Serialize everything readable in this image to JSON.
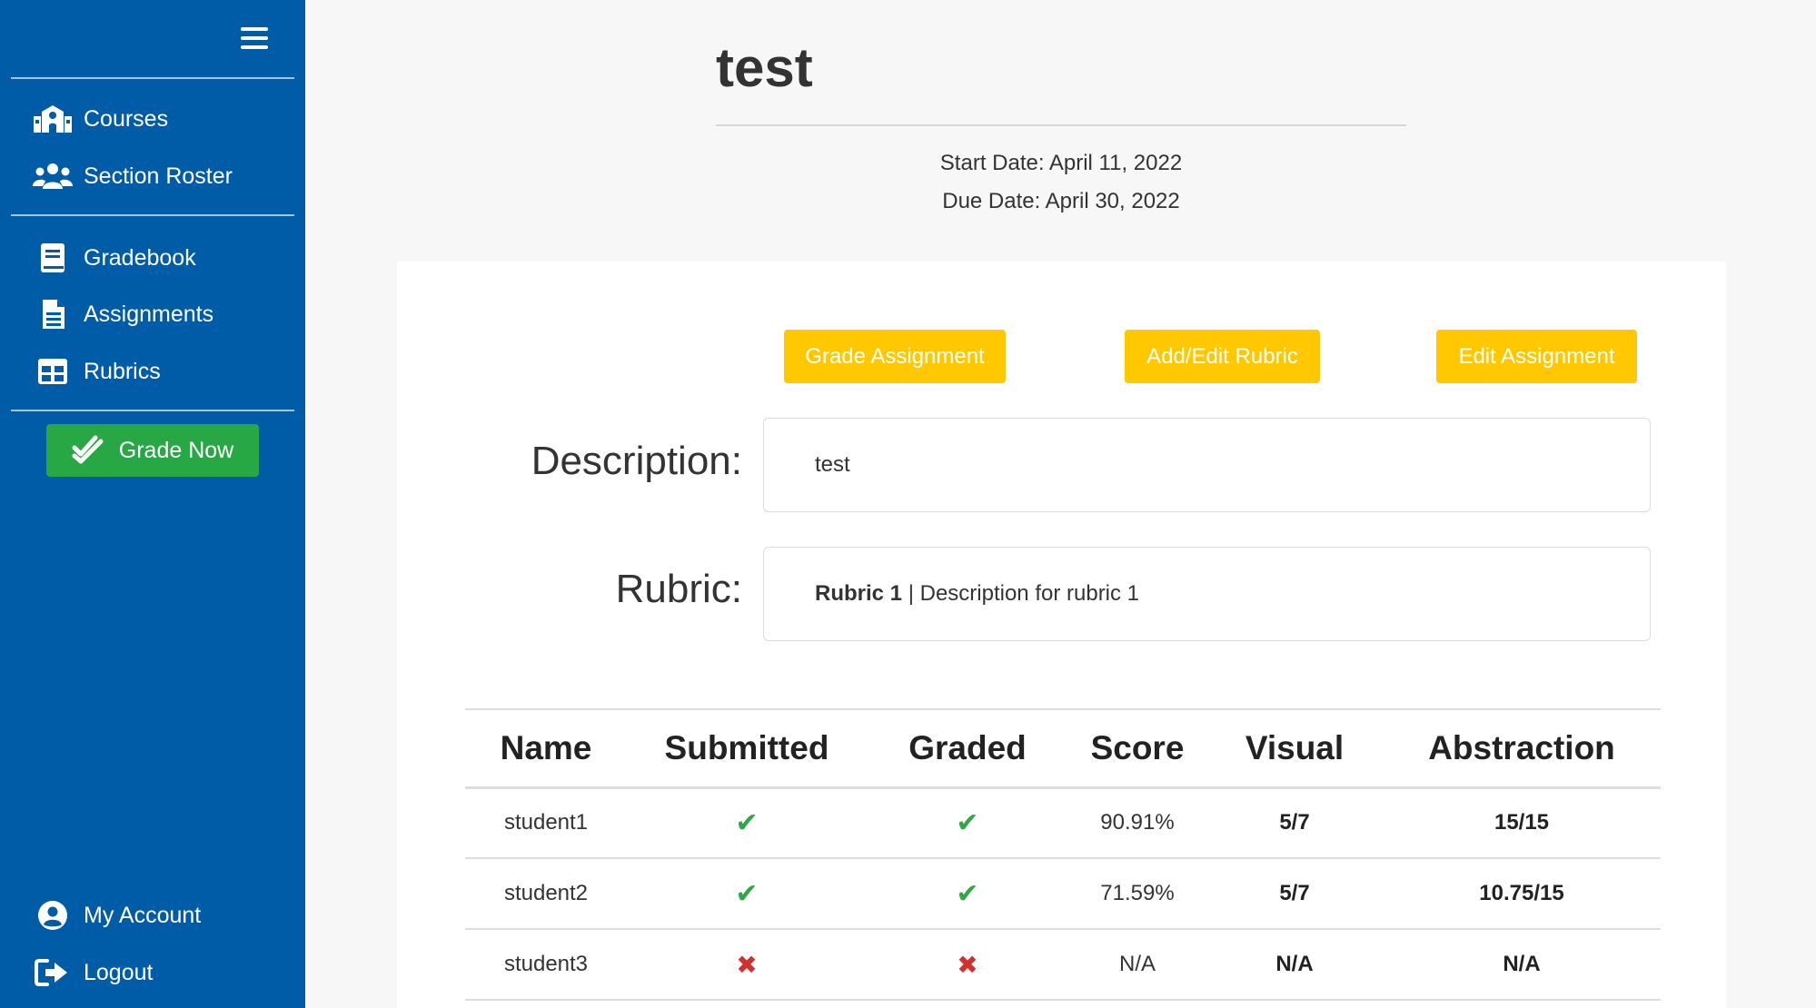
{
  "sidebar": {
    "menu_icon": "hamburger-icon",
    "items": [
      {
        "label": "Courses",
        "icon": "school-icon"
      },
      {
        "label": "Section Roster",
        "icon": "users-icon"
      },
      {
        "label": "Gradebook",
        "icon": "book-icon"
      },
      {
        "label": "Assignments",
        "icon": "file-text-icon"
      },
      {
        "label": "Rubrics",
        "icon": "table-icon"
      }
    ],
    "grade_now": {
      "label": "Grade Now",
      "icon": "double-check-icon",
      "color": "#28a745"
    },
    "bottom_items": [
      {
        "label": "My Account",
        "icon": "user-circle-icon"
      },
      {
        "label": "Logout",
        "icon": "sign-out-icon"
      }
    ],
    "background": "#005ca6"
  },
  "header": {
    "title": "test",
    "start_date": "Start Date: April 11, 2022",
    "due_date": "Due Date: April 30, 2022"
  },
  "actions": {
    "grade_assignment": "Grade Assignment",
    "edit_rubric": "Add/Edit Rubric",
    "edit_assignment": "Edit Assignment",
    "color": "#ffc800"
  },
  "details": {
    "description_label": "Description:",
    "description_value": "test",
    "rubric_label": "Rubric:",
    "rubric_name": "Rubric 1",
    "rubric_separator": " | ",
    "rubric_description": "Description for rubric 1"
  },
  "table": {
    "headers": [
      "Name",
      "Submitted",
      "Graded",
      "Score",
      "Visual",
      "Abstraction"
    ],
    "rows": [
      {
        "name": "student1",
        "submitted": true,
        "graded": true,
        "score": "90.91%",
        "visual": "5/7",
        "abstraction": "15/15"
      },
      {
        "name": "student2",
        "submitted": true,
        "graded": true,
        "score": "71.59%",
        "visual": "5/7",
        "abstraction": "10.75/15"
      },
      {
        "name": "student3",
        "submitted": false,
        "graded": false,
        "score": "N/A",
        "visual": "N/A",
        "abstraction": "N/A"
      }
    ],
    "check_symbol": "✔",
    "cross_symbol": "✖"
  }
}
